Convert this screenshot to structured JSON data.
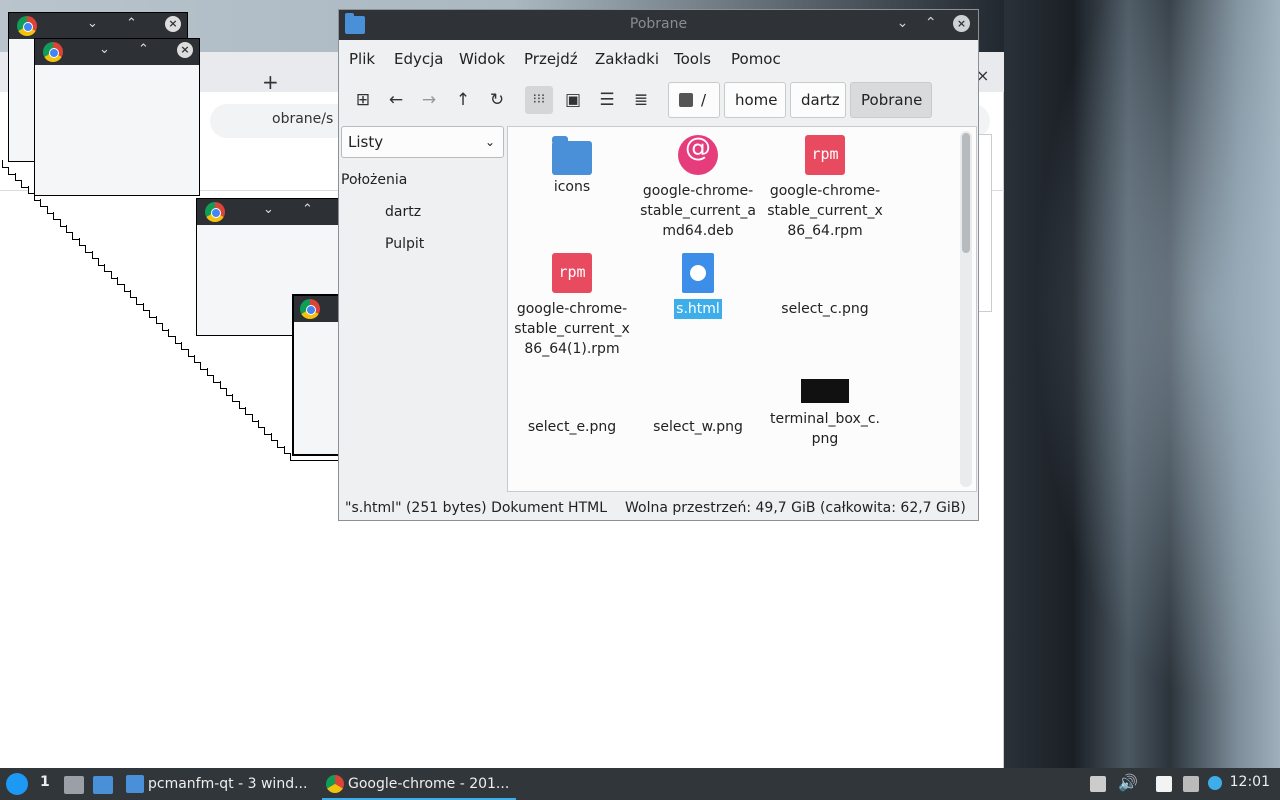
{
  "chrome": {
    "new_tab": "+",
    "close": "×",
    "url": "obrane/s"
  },
  "ghost_windows": {
    "buttons": "⌄ ⌃",
    "close": "×"
  },
  "file_manager": {
    "title": "Pobrane",
    "title_buttons": {
      "minimize": "⌄",
      "maximize": "⌃",
      "close": "×"
    },
    "menu": [
      "Plik",
      "Edycja",
      "Widok",
      "Przejdź",
      "Zakładki",
      "Tools",
      "Pomoc"
    ],
    "toolbar_icons": [
      "new-tab-icon",
      "back-icon",
      "forward-icon",
      "up-icon",
      "reload-icon",
      "icon-view-icon",
      "thumbnail-view-icon",
      "compact-view-icon",
      "detailed-view-icon"
    ],
    "breadcrumbs": [
      {
        "label": "/",
        "icon": "root-icon"
      },
      {
        "label": "home"
      },
      {
        "label": "dartz"
      },
      {
        "label": "Pobrane",
        "current": true
      }
    ],
    "side_panel": {
      "mode": "Listy",
      "heading": "Położenia",
      "items": [
        "dartz",
        "Pulpit"
      ]
    },
    "files": [
      {
        "name": "icons",
        "icon": "folder-icon"
      },
      {
        "name": "google-chrome-stable_current_amd64.deb",
        "display": "google-chrome-\nstable_current_a\nmd64.deb",
        "icon": "debian-package-icon"
      },
      {
        "name": "google-chrome-stable_current_x86_64.rpm",
        "display": "google-chrome-\nstable_current_x\n86_64.rpm",
        "icon": "rpm-package-icon"
      },
      {
        "name": "google-chrome-stable_current_x86_64(1).rpm",
        "display": "google-chrome-\nstable_current_x\n86_64(1).rpm",
        "icon": "rpm-package-icon"
      },
      {
        "name": "s.html",
        "display": "s.html",
        "icon": "html-file-icon",
        "selected": true
      },
      {
        "name": "select_c.png",
        "display": "select_c.png",
        "icon": "image-file-icon"
      },
      {
        "name": "select_e.png",
        "display": "select_e.png",
        "icon": "image-file-icon"
      },
      {
        "name": "select_w.png",
        "display": "select_w.png",
        "icon": "image-file-icon"
      },
      {
        "name": "terminal_box_c.png",
        "display": "terminal_box_c.\npng",
        "icon": "image-thumbnail-icon"
      }
    ],
    "status": {
      "selection": "\"s.html\" (251 bytes) Dokument HTML",
      "free_space": "Wolna przestrzeń: 49,7 GiB (całkowita: 62,7 GiB)"
    }
  },
  "taskbar": {
    "workspace": "1",
    "tasks": [
      {
        "label": "pcmanfm-qt - 3 wind...",
        "active": false
      },
      {
        "label": "Google-chrome - 201...",
        "active": true
      }
    ],
    "clock": "12:01"
  }
}
